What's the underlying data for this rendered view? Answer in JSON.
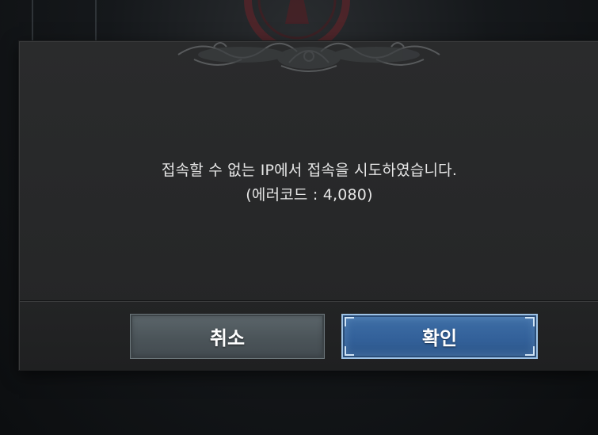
{
  "dialog": {
    "message_line1": "접속할 수 없는 IP에서 접속을 시도하였습니다.",
    "message_line2": "(에러코드 : 4,080)"
  },
  "buttons": {
    "cancel_label": "취소",
    "confirm_label": "확인"
  },
  "colors": {
    "dialog_bg": "#2a2b2c",
    "cancel_button": "#4f585d",
    "confirm_button": "#3a6aa2",
    "confirm_border": "#9ec3e6",
    "background_emblem": "#7a2a30"
  },
  "icons": {
    "background_emblem": "faction-emblem-icon",
    "dialog_ornament": "filigree-ornament-icon"
  }
}
